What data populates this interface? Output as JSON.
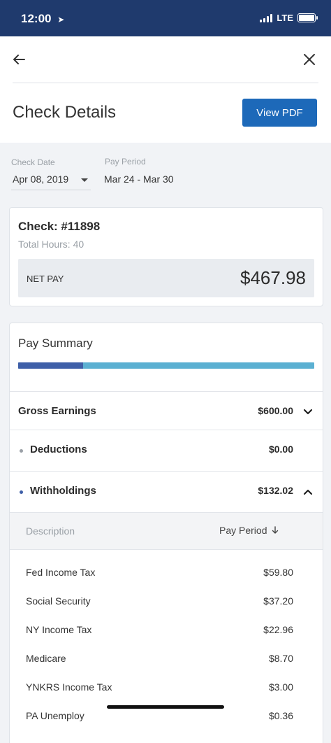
{
  "status_bar": {
    "time": "12:00",
    "network": "LTE"
  },
  "header": {
    "title": "Check Details",
    "view_pdf_label": "View PDF"
  },
  "filters": {
    "check_date_label": "Check Date",
    "check_date_value": "Apr 08, 2019",
    "pay_period_label": "Pay Period",
    "pay_period_value": "Mar 24 - Mar 30"
  },
  "check": {
    "number": "Check: #11898",
    "total_hours": "Total Hours: 40",
    "net_pay_label": "NET PAY",
    "net_pay_amount": "$467.98"
  },
  "pay_summary": {
    "title": "Pay Summary",
    "bar": {
      "net_fraction": 0.22,
      "colors": {
        "primary": "#3e5fa8",
        "secondary": "#5bb0d2"
      }
    },
    "rows": [
      {
        "label": "Gross Earnings",
        "amount": "$600.00",
        "expanded": false
      },
      {
        "label": "Deductions",
        "amount": "$0.00",
        "expanded": false
      },
      {
        "label": "Withholdings",
        "amount": "$132.02",
        "expanded": true
      }
    ],
    "details_header": {
      "description": "Description",
      "pay_period": "Pay Period"
    },
    "withholdings": [
      {
        "name": "Fed Income Tax",
        "amount": "$59.80"
      },
      {
        "name": "Social Security",
        "amount": "$37.20"
      },
      {
        "name": "NY Income Tax",
        "amount": "$22.96"
      },
      {
        "name": "Medicare",
        "amount": "$8.70"
      },
      {
        "name": "YNKRS Income Tax",
        "amount": "$3.00"
      },
      {
        "name": "PA Unemploy",
        "amount": "$0.36"
      }
    ]
  },
  "colors": {
    "status_bar": "#1f3a6d",
    "accent_button": "#1d69b9"
  }
}
